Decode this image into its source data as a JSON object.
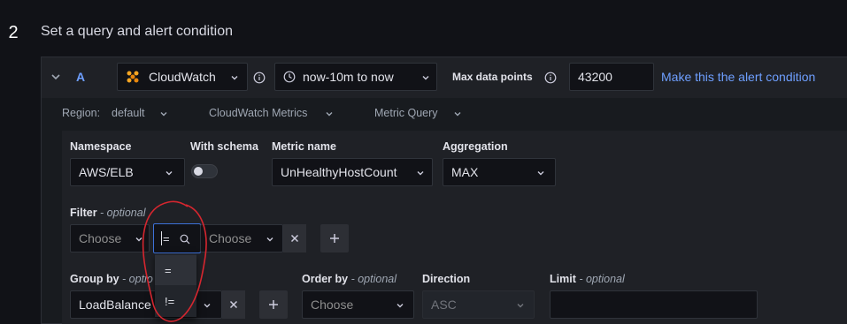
{
  "step": {
    "number": "2",
    "title": "Set a query and alert condition"
  },
  "query": {
    "ref_id": "A",
    "datasource": "CloudWatch",
    "time_range": "now-10m to now",
    "max_data_points_label": "Max data points",
    "max_data_points_value": "43200",
    "alert_condition_link": "Make this the alert condition"
  },
  "region_row": {
    "region_label": "Region:",
    "region_value": "default",
    "metrics_type": "CloudWatch Metrics",
    "query_type": "Metric Query"
  },
  "metric": {
    "namespace_label": "Namespace",
    "namespace_value": "AWS/ELB",
    "schema_label": "With schema",
    "metric_name_label": "Metric name",
    "metric_name_value": "UnHealthyHostCount",
    "aggregation_label": "Aggregation",
    "aggregation_value": "MAX"
  },
  "filter": {
    "label": "Filter",
    "optional": "- optional",
    "key_placeholder": "Choose",
    "operator_value": "=",
    "value_placeholder": "Choose",
    "operator_options": [
      "=",
      "!="
    ]
  },
  "group_by": {
    "label": "Group by",
    "optional": "- optio",
    "value": "LoadBalance"
  },
  "order_by": {
    "label": "Order by",
    "optional": "- optional",
    "placeholder": "Choose"
  },
  "direction": {
    "label": "Direction",
    "value": "ASC"
  },
  "limit": {
    "label": "Limit",
    "optional": "- optional"
  },
  "colors": {
    "accent": "#6e9fff",
    "focus_border": "#3d71d9",
    "annotation": "#d6262f",
    "background": "#111217",
    "panel": "#181b1f"
  }
}
